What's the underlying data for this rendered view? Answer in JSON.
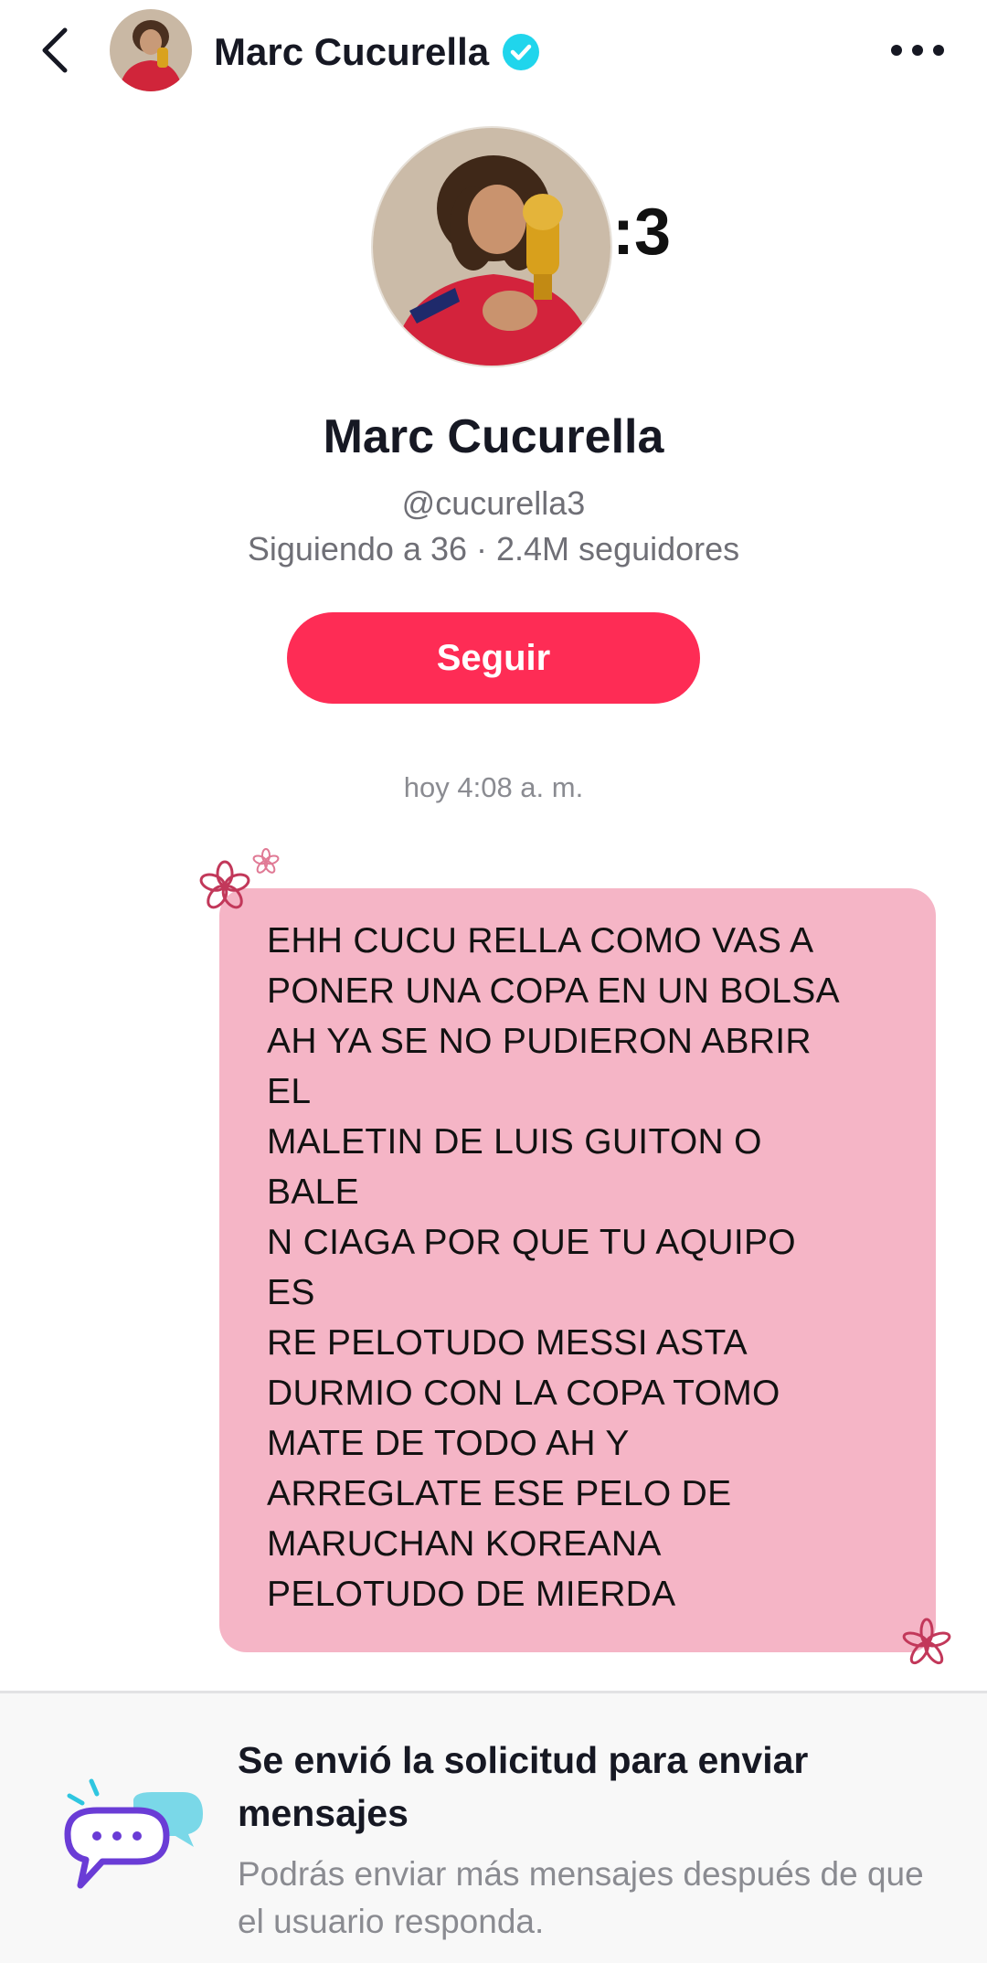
{
  "header": {
    "back_icon": "chevron-left-icon",
    "name": "Marc Cucurella",
    "verified_icon": "verified-badge-icon",
    "more_icon": "more-horizontal-icon"
  },
  "profile": {
    "avatar_suffix": ":3",
    "name": "Marc Cucurella",
    "handle": "@cucurella3",
    "stats": "Siguiendo a 36 · 2.4M seguidores",
    "follow_label": "Seguir"
  },
  "chat": {
    "timestamp": "hoy 4:08 a. m.",
    "message_lines": [
      "EHH CUCU RELLA COMO VAS A",
      "PONER UNA COPA EN UN BOLSA",
      "AH YA SE NO PUDIERON ABRIR",
      "EL",
      "MALETIN DE LUIS GUITON O",
      "BALE",
      "N CIAGA POR QUE TU AQUIPO",
      "ES",
      "RE PELOTUDO MESSI ASTA",
      "DURMIO CON LA COPA TOMO",
      "MATE DE TODO AH Y",
      "ARREGLATE ESE PELO DE",
      "MARUCHAN KOREANA",
      "PELOTUDO DE MIERDA"
    ],
    "bubble_color": "#f5b5c6"
  },
  "notice": {
    "icon": "message-bubbles-icon",
    "title": "Se envió la solicitud para enviar mensajes",
    "subtitle": "Podrás enviar más mensajes después de que el usuario responda."
  },
  "colors": {
    "accent": "#fe2c55",
    "verified": "#20d5ec",
    "muted_text": "#8a8b91"
  }
}
